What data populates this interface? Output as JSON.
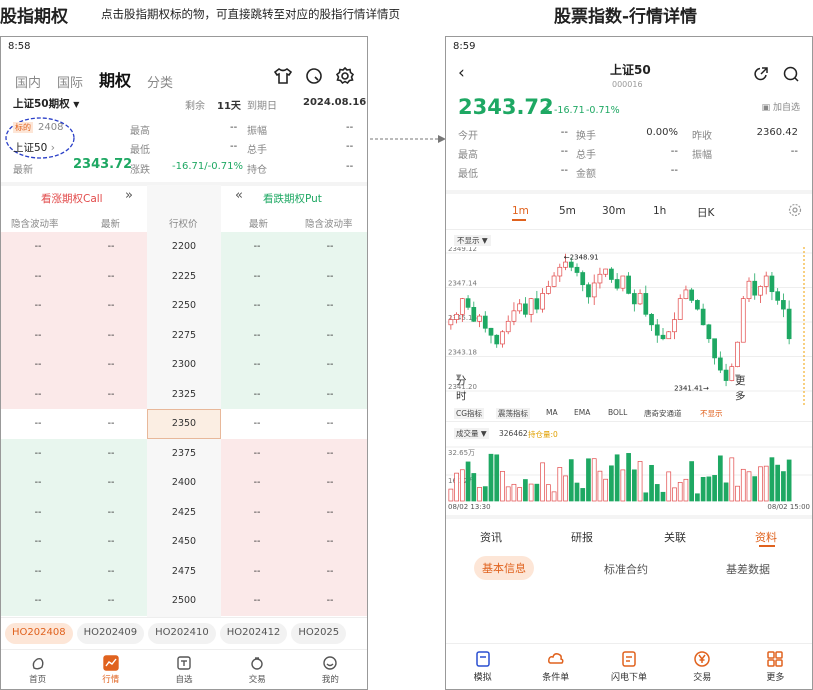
{
  "headers": {
    "left_title": "股指期权",
    "left_note": "点击股指期权标的物，可直接跳转至对应的股指行情详情页",
    "right_title": "股票指数-行情详情"
  },
  "left": {
    "status_time": "8:58",
    "tabs": [
      "国内",
      "国际",
      "期权",
      "分类"
    ],
    "selector": "上证50期权",
    "remain_label": "剩余",
    "remain_value": "11天",
    "expiry_label": "到期日",
    "expiry_value": "2024.08.16",
    "tag_label": "标的",
    "tag_value": "2408",
    "underlying_name": "上证50",
    "latest_label": "最新",
    "latest_value": "2343.72",
    "high_label": "最高",
    "high_value": "--",
    "amp_label": "振幅",
    "amp_value": "--",
    "low_label": "最低",
    "low_value": "--",
    "vol_label": "总手",
    "vol_value": "--",
    "chg_label": "涨跌",
    "chg_value": "-16.71/-0.71%",
    "oi_label": "持仓",
    "oi_value": "--",
    "call_label": "看涨期权Call",
    "put_label": "看跌期权Put",
    "call_arrow": "»",
    "put_arrow": "«",
    "col_headers": [
      "隐含波动率",
      "最新",
      "行权价",
      "最新",
      "隐含波动率"
    ],
    "strikes": [
      "2200",
      "2225",
      "2250",
      "2275",
      "2300",
      "2325",
      "2350",
      "2375",
      "2400",
      "2425",
      "2450",
      "2475",
      "2500"
    ],
    "atm_strike": "2350",
    "placeholder": "--",
    "chips": [
      "HO202408",
      "HO202409",
      "HO202410",
      "HO202412",
      "HO2025"
    ],
    "nav": [
      "首页",
      "行情",
      "自选",
      "交易",
      "我的"
    ]
  },
  "right": {
    "status_time": "8:59",
    "name": "上证50",
    "code": "000016",
    "price": "2343.72",
    "arrow": "↓",
    "change": "-16.71",
    "change_pct": "-0.71%",
    "add_watch": "加自选",
    "stats": [
      {
        "label": "今开",
        "value": "--"
      },
      {
        "label": "换手",
        "value": "0.00%"
      },
      {
        "label": "昨收",
        "value": "2360.42"
      },
      {
        "label": "最高",
        "value": "--"
      },
      {
        "label": "总手",
        "value": "--"
      },
      {
        "label": "振幅",
        "value": "--"
      },
      {
        "label": "最低",
        "value": "--"
      },
      {
        "label": "金额",
        "value": "--"
      }
    ],
    "time_tabs": [
      "分时",
      "1m",
      "5m",
      "30m",
      "1h",
      "日K",
      "更多"
    ],
    "active_time_tab": "1m",
    "hide_label": "不显示",
    "y_labels": [
      "2349.12",
      "2347.14",
      "2345.16",
      "2343.18",
      "2341.20"
    ],
    "high_marker": "2348.91",
    "low_marker": "2341.41",
    "indicators": [
      "CG指标",
      "震荡指标",
      "MA",
      "EMA",
      "BOLL",
      "唐奇安通道",
      "不显示"
    ],
    "vol_label": "成交量",
    "vol_value": "326462",
    "oi_label": "持仓量:0",
    "vol_y": [
      "32.65万",
      "16.32万"
    ],
    "time_start": "08/02 13:30",
    "time_end": "08/02 15:00",
    "sub_tabs": [
      "资讯",
      "研报",
      "关联",
      "资料"
    ],
    "active_sub_tab": "资料",
    "sub2": [
      "基本信息",
      "标准合约",
      "基差数据"
    ],
    "actions": [
      "模拟",
      "条件单",
      "闪电下单",
      "交易",
      "更多"
    ],
    "colors": {
      "up": "#e24a4a",
      "down": "#1ea863",
      "accent": "#e0621e"
    }
  }
}
